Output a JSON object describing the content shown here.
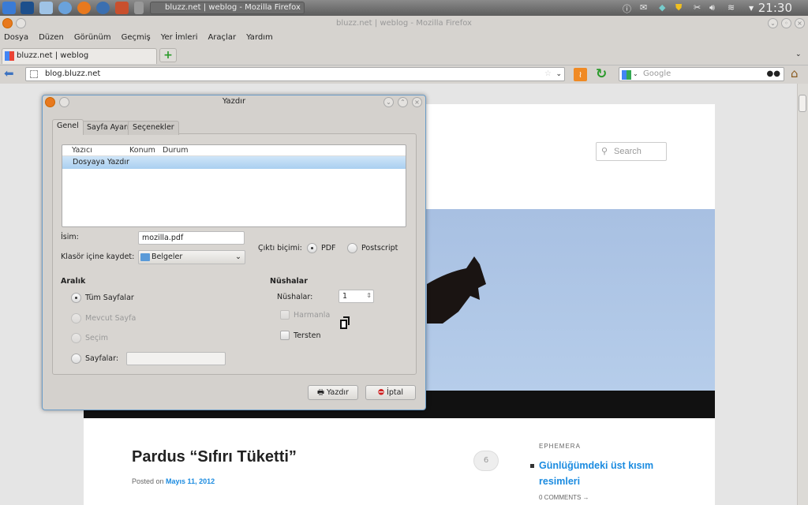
{
  "taskbar": {
    "task_title": "bluzz.net | weblog - Mozilla Firefox",
    "clock": "21:30"
  },
  "window": {
    "title": "bluzz.net | weblog - Mozilla Firefox"
  },
  "menu": [
    "Dosya",
    "Düzen",
    "Görünüm",
    "Geçmiş",
    "Yer İmleri",
    "Araçlar",
    "Yardım"
  ],
  "tabs": [
    {
      "label": "bluzz.net | weblog"
    }
  ],
  "nav": {
    "url": "blog.bluzz.net",
    "search_placeholder": "Google"
  },
  "blog": {
    "search_placeholder": "Search",
    "post_title": "Pardus “Sıfırı Tüketti”",
    "posted_on": "Posted on",
    "date": "Mayıs 11, 2012",
    "comment_count": "6",
    "sidebar_heading": "EPHEMERA",
    "sidebar_link": "Günlüğümdeki üst kısım resimleri",
    "sidebar_comments": "0 COMMENTS →"
  },
  "dialog": {
    "title": "Yazdır",
    "tabs": [
      "Genel",
      "Sayfa Ayarı",
      "Seçenekler"
    ],
    "columns": [
      "Yazıcı",
      "Konum",
      "Durum"
    ],
    "printers": [
      "Dosyaya Yazdır"
    ],
    "name_label": "İsim:",
    "name_value": "mozilla.pdf",
    "folder_label": "Klasör içine kaydet:",
    "folder_value": "Belgeler",
    "format_label": "Çıktı biçimi:",
    "format_pdf": "PDF",
    "format_ps": "Postscript",
    "range_heading": "Aralık",
    "range_all": "Tüm Sayfalar",
    "range_current": "Mevcut Sayfa",
    "range_selection": "Seçim",
    "range_pages": "Sayfalar:",
    "copies_heading": "Nüshalar",
    "copies_label": "Nüshalar:",
    "copies_value": "1",
    "collate": "Harmanla",
    "reverse": "Tersten",
    "print_button": "Yazdır",
    "cancel_button": "İptal"
  }
}
